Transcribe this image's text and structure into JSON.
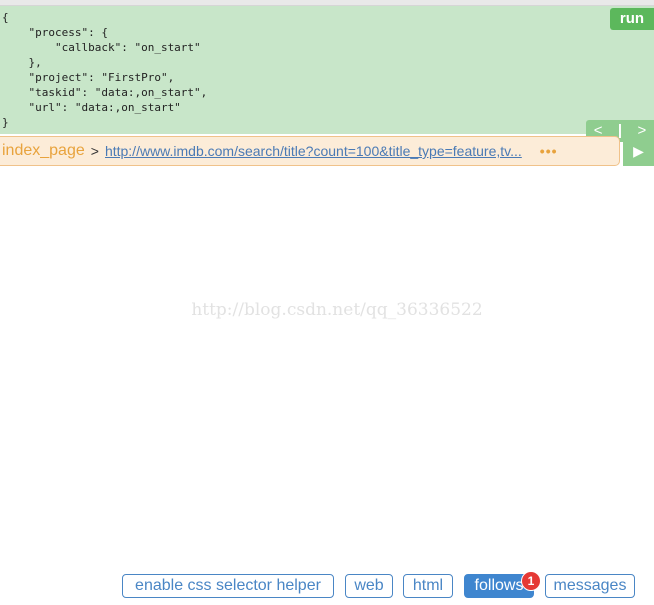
{
  "task": {
    "json_text": "{\n    \"process\": {\n        \"callback\": \"on_start\"\n    },\n    \"project\": \"FirstPro\",\n    \"taskid\": \"data:,on_start\",\n    \"url\": \"data:,on_start\"\n}",
    "run_label": "run",
    "prev_label": "<",
    "separator": "|",
    "next_label": ">"
  },
  "request": {
    "callback": "index_page",
    "arrow": ">",
    "url": "http://www.imdb.com/search/title?count=100&title_type=feature,tv...",
    "more_label": "•••",
    "play_label": "▶"
  },
  "watermark": "http://blog.csdn.net/qq_36336522",
  "tabs": {
    "css_helper": "enable css selector helper",
    "web": "web",
    "html": "html",
    "follows": "follows",
    "follows_badge": "1",
    "messages": "messages"
  },
  "colors": {
    "panel_green": "#c8e6c9",
    "run_green": "#5cb85c",
    "callback_orange": "#e8a33d",
    "tab_blue": "#3f86cf",
    "badge_red": "#e53935"
  }
}
